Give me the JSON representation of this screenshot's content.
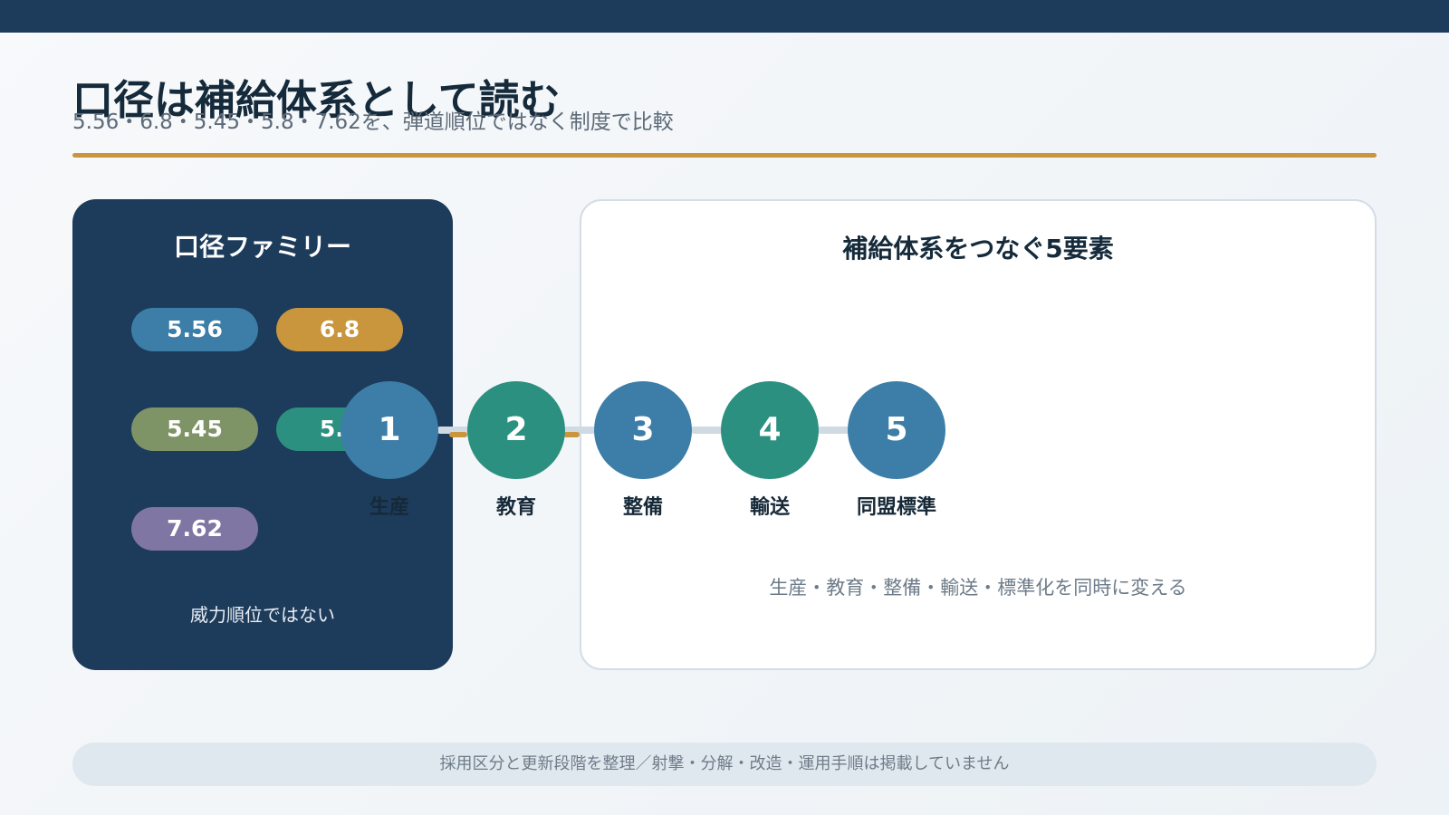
{
  "header": {
    "title": "口径は補給体系として読む",
    "subtitle": "5.56・6.8・5.45・5.8・7.62を、弾道順位ではなく制度で比較"
  },
  "family_panel": {
    "title": "口径ファミリー",
    "pills": [
      {
        "label": "5.56",
        "color": "#3c7ea8"
      },
      {
        "label": "6.8",
        "color": "#c9953d"
      },
      {
        "label": "5.45",
        "color": "#7f9466"
      },
      {
        "label": "5.8",
        "color": "#2b907f"
      },
      {
        "label": "7.62",
        "color": "#7f76a3"
      }
    ],
    "note": "威力順位ではない"
  },
  "elements_panel": {
    "title": "補給体系をつなぐ5要素",
    "steps": [
      {
        "number": "1",
        "label": "生産",
        "color": "#3c7ea8"
      },
      {
        "number": "2",
        "label": "教育",
        "color": "#2b907f"
      },
      {
        "number": "3",
        "label": "整備",
        "color": "#3c7ea8"
      },
      {
        "number": "4",
        "label": "輸送",
        "color": "#2b907f"
      },
      {
        "number": "5",
        "label": "同盟標準",
        "color": "#3c7ea8"
      }
    ],
    "note": "生産・教育・整備・輸送・標準化を同時に変える"
  },
  "footer": {
    "note": "採用区分と更新段階を整理／射撃・分解・改造・運用手順は掲載していません"
  },
  "colors": {
    "navy": "#1d3b5a",
    "gold": "#c9953d",
    "blue": "#3c7ea8",
    "teal": "#2b907f",
    "green": "#7f9466",
    "purple": "#7f76a3"
  }
}
